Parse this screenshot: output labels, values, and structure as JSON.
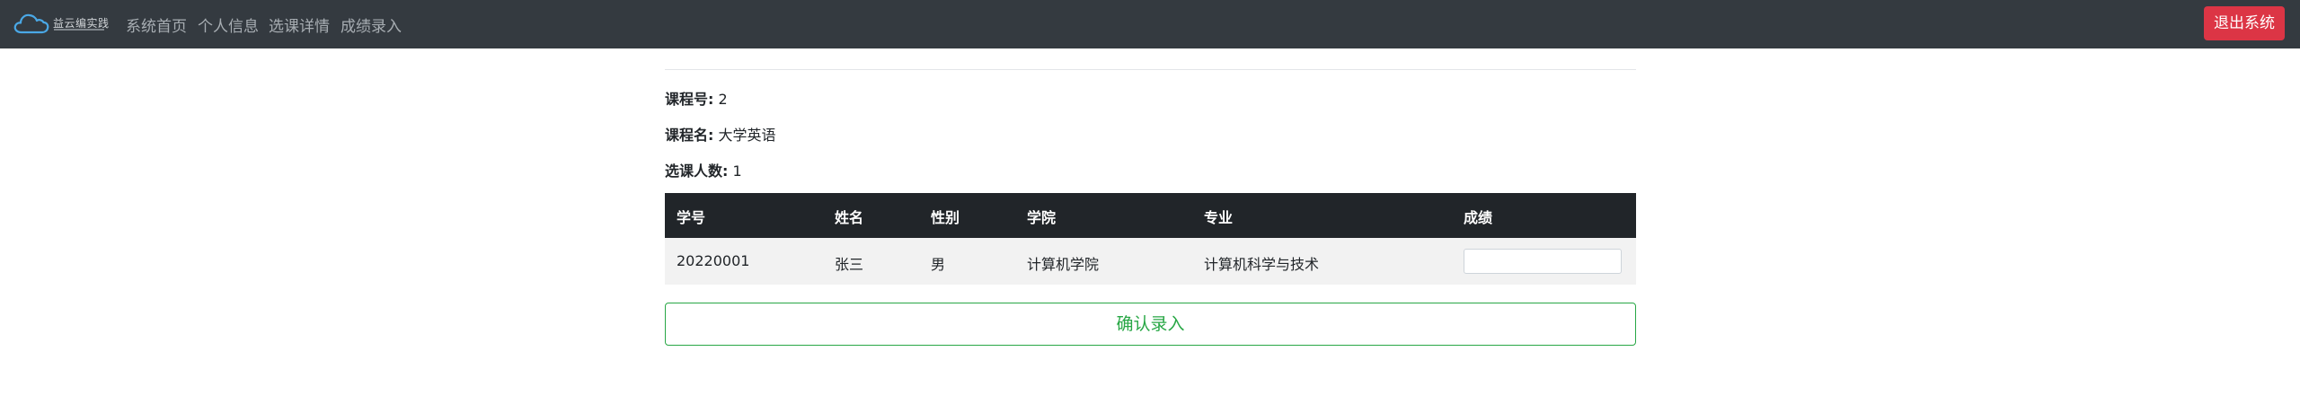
{
  "brand": {
    "logo_text": "益云编实践",
    "logo_icon": "cloud-icon"
  },
  "nav": {
    "items": [
      {
        "label": "系统首页"
      },
      {
        "label": "个人信息"
      },
      {
        "label": "选课详情"
      },
      {
        "label": "成绩录入"
      }
    ],
    "logout_label": "退出系统"
  },
  "course": {
    "id_label": "课程号:",
    "id_value": "2",
    "name_label": "课程名:",
    "name_value": "大学英语",
    "count_label": "选课人数:",
    "count_value": "1"
  },
  "table": {
    "headers": [
      "学号",
      "姓名",
      "性别",
      "学院",
      "专业",
      "成绩"
    ],
    "rows": [
      {
        "student_id": "20220001",
        "name": "张三",
        "gender": "男",
        "college": "计算机学院",
        "major": "计算机科学与技术",
        "score": ""
      }
    ]
  },
  "actions": {
    "confirm_label": "确认录入"
  },
  "colors": {
    "navbar": "#343a40",
    "danger": "#dc3545",
    "success": "#28a745",
    "table_head": "#212529"
  }
}
